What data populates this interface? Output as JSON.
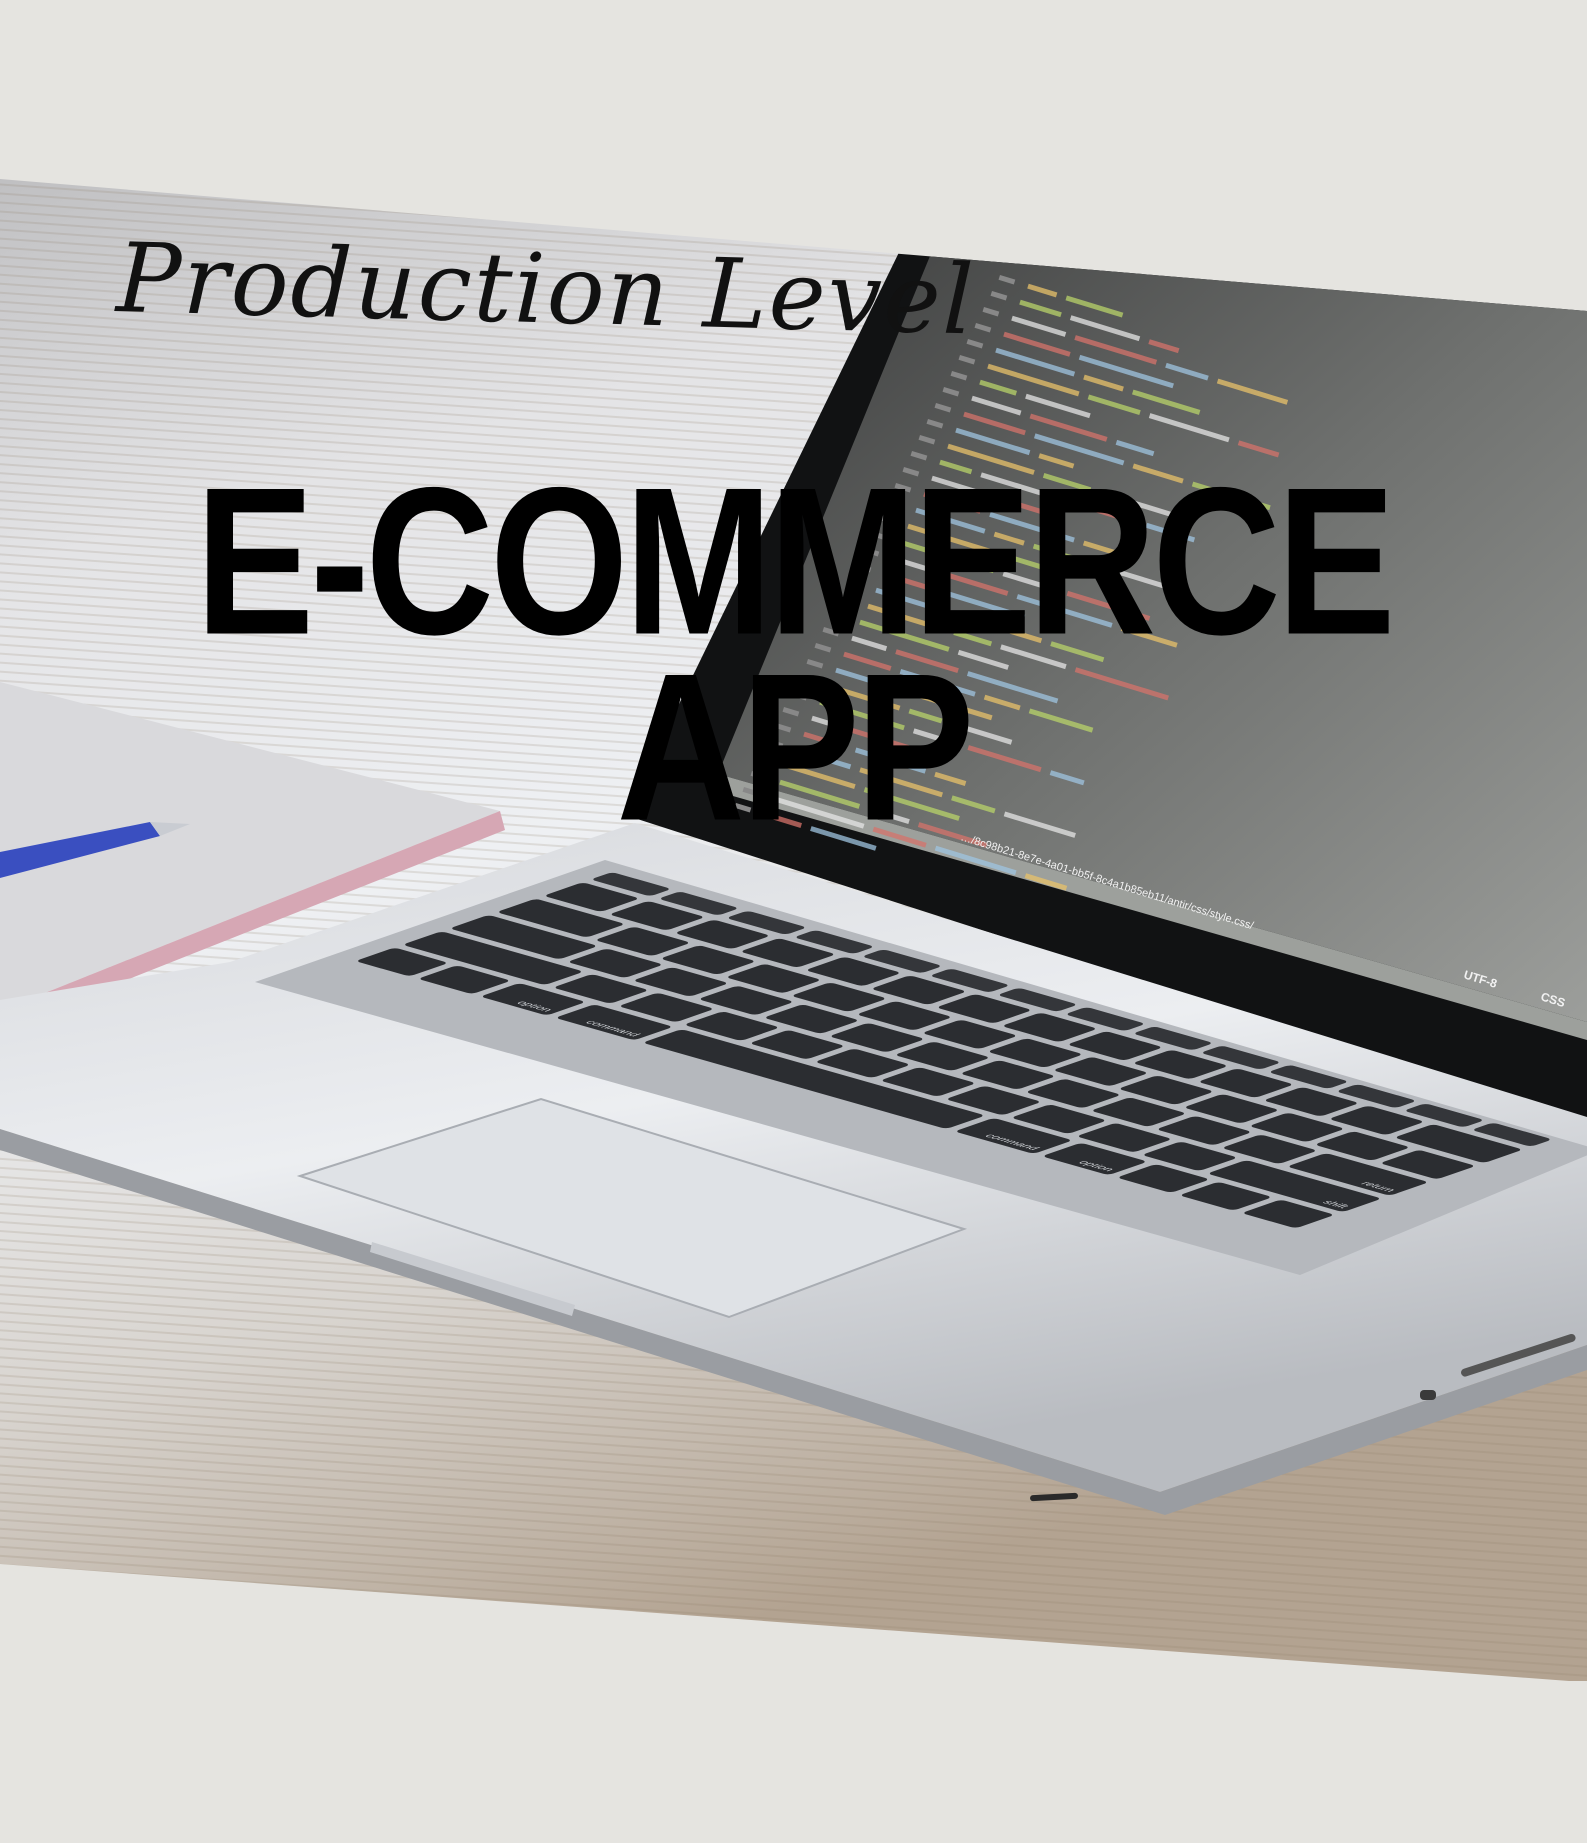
{
  "poster": {
    "script_title": "Production Level",
    "headline_line1": "E-COMMERCE",
    "headline_line2": "APP"
  },
  "laptop_screen": {
    "file_path": "…/8c98b21-8e7e-4a01-bb5f-8c4a1b85eb11/antir/css/style.css/",
    "status_encoding": "UTF-8",
    "status_language": "CSS"
  },
  "keyboard": {
    "key_command": "command",
    "key_option": "option",
    "key_shift": "shift",
    "key_return": "return"
  },
  "colors": {
    "background": "#e5e4e0",
    "text": "#000000",
    "pen": "#3a4fc0"
  }
}
